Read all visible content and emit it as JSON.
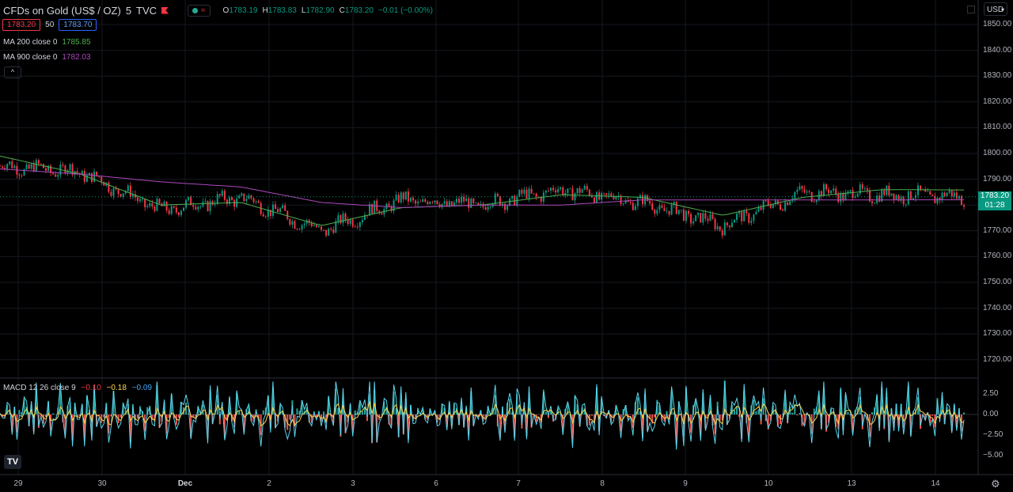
{
  "header": {
    "symbol": "CFDs on Gold (US$ / OZ)",
    "interval": "5",
    "exchange": "TVC",
    "wave_icon": "≈",
    "ohlc": {
      "o_label": "O",
      "o": "1783.19",
      "h_label": "H",
      "h": "1783.83",
      "l_label": "L",
      "l": "1782.90",
      "c_label": "C",
      "c": "1783.20",
      "change": "−0.01 (−0.00%)"
    }
  },
  "quote": {
    "bid": "1783.20",
    "spread": "50",
    "ask": "1783.70"
  },
  "indicators": {
    "ma200": {
      "label": "MA 200 close 0",
      "value": "1785.85",
      "color": "#4caf50"
    },
    "ma900": {
      "label": "MA 900 close 0",
      "value": "1782.03",
      "color": "#ab47bc"
    }
  },
  "collapse_icon": "^",
  "macd": {
    "label": "MACD 12 26 close 9",
    "hist": "−0.10",
    "macd": "−0.18",
    "signal": "−0.09",
    "yticks": [
      "2.50",
      "0.00",
      "−2.50",
      "−5.00"
    ]
  },
  "price_axis": {
    "currency": "USD",
    "ticks": [
      "1850.00",
      "1840.00",
      "1830.00",
      "1820.00",
      "1810.00",
      "1800.00",
      "1790.00",
      "1780.00",
      "1770.00",
      "1760.00",
      "1750.00",
      "1740.00",
      "1730.00",
      "1720.00"
    ],
    "last_price": "1783.20",
    "countdown": "01:28"
  },
  "time_axis": [
    "29",
    "30",
    "Dec",
    "2",
    "3",
    "6",
    "7",
    "8",
    "9",
    "10",
    "13",
    "14"
  ],
  "colors": {
    "up": "#089981",
    "down": "#f23645",
    "ma200": "#4caf50",
    "ma900": "#ab47bc",
    "macd": "#5ad5ee",
    "signal": "#ffd54f"
  },
  "chart_data": {
    "type": "line",
    "title": "CFDs on Gold (US$ / OZ)",
    "interval": "5",
    "x": [
      "29",
      "30",
      "Dec",
      "2",
      "3",
      "6",
      "7",
      "8",
      "9",
      "10",
      "13",
      "14"
    ],
    "ylim": [
      1715,
      1855
    ],
    "series": [
      {
        "name": "Close",
        "values": [
          1795,
          1793,
          1778,
          1783,
          1770,
          1782,
          1780,
          1786,
          1781,
          1772,
          1785,
          1784,
          1783.2
        ]
      },
      {
        "name": "MA 200 close 0",
        "values": [
          1799,
          1792,
          1780,
          1781,
          1772,
          1779,
          1780,
          1784,
          1783,
          1776,
          1783,
          1786,
          1785.85
        ]
      },
      {
        "name": "MA 900 close 0",
        "values": [
          1794,
          1792,
          1789,
          1787,
          1781,
          1779,
          1780,
          1780,
          1782,
          1782,
          1782,
          1782,
          1782.03
        ]
      }
    ],
    "macd": {
      "hist": -0.1,
      "macd": -0.18,
      "signal": -0.09,
      "ylim": [
        -6.5,
        4.5
      ]
    }
  }
}
